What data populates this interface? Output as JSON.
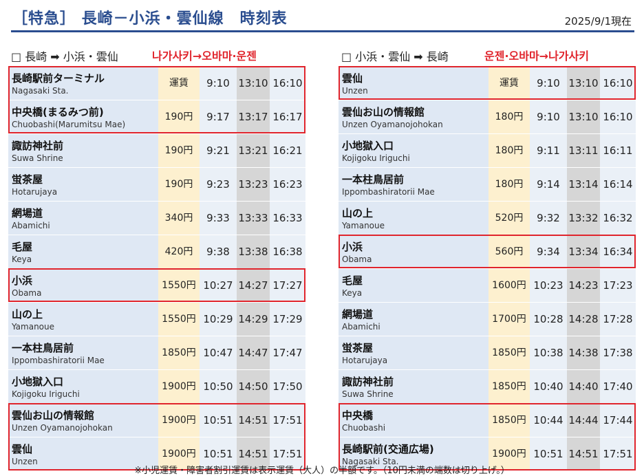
{
  "header": {
    "title": "［特急］ 長崎－小浜・雲仙線　時刻表",
    "date": "2025/9/1現在"
  },
  "left": {
    "direction": "□ 長崎 ➡ 小浜・雲仙",
    "korean": "나가사키→오바마·운젠",
    "rows": [
      {
        "ja": "長崎駅前ターミナル",
        "en": "Nagasaki Sta.",
        "fare": "運賃",
        "t1": "9:10",
        "t2": "13:10",
        "t3": "16:10"
      },
      {
        "ja": "中央橋(まるみつ前)",
        "en": "Chuobashi(Marumitsu Mae)",
        "fare": "190円",
        "t1": "9:17",
        "t2": "13:17",
        "t3": "16:17"
      },
      {
        "ja": "諏訪神社前",
        "en": "Suwa Shrine",
        "fare": "190円",
        "t1": "9:21",
        "t2": "13:21",
        "t3": "16:21"
      },
      {
        "ja": "蛍茶屋",
        "en": "Hotarujaya",
        "fare": "190円",
        "t1": "9:23",
        "t2": "13:23",
        "t3": "16:23"
      },
      {
        "ja": "網場道",
        "en": "Abamichi",
        "fare": "340円",
        "t1": "9:33",
        "t2": "13:33",
        "t3": "16:33"
      },
      {
        "ja": "毛屋",
        "en": "Keya",
        "fare": "420円",
        "t1": "9:38",
        "t2": "13:38",
        "t3": "16:38"
      },
      {
        "ja": "小浜",
        "en": "Obama",
        "fare": "1550円",
        "t1": "10:27",
        "t2": "14:27",
        "t3": "17:27"
      },
      {
        "ja": "山の上",
        "en": "Yamanoue",
        "fare": "1550円",
        "t1": "10:29",
        "t2": "14:29",
        "t3": "17:29"
      },
      {
        "ja": "一本柱鳥居前",
        "en": "Ippombashiratorii Mae",
        "fare": "1850円",
        "t1": "10:47",
        "t2": "14:47",
        "t3": "17:47"
      },
      {
        "ja": "小地獄入口",
        "en": "Kojigoku Iriguchi",
        "fare": "1900円",
        "t1": "10:50",
        "t2": "14:50",
        "t3": "17:50"
      },
      {
        "ja": "雲仙お山の情報館",
        "en": "Unzen Oyamanojohokan",
        "fare": "1900円",
        "t1": "10:51",
        "t2": "14:51",
        "t3": "17:51"
      },
      {
        "ja": "雲仙",
        "en": "Unzen",
        "fare": "1900円",
        "t1": "10:51",
        "t2": "14:51",
        "t3": "17:51"
      }
    ]
  },
  "right": {
    "direction": "□ 小浜・雲仙 ➡ 長崎",
    "korean": "운젠·오바마→나가사키",
    "rows": [
      {
        "ja": "雲仙",
        "en": "Unzen",
        "fare": "運賃",
        "t1": "9:10",
        "t2": "13:10",
        "t3": "16:10"
      },
      {
        "ja": "雲仙お山の情報館",
        "en": "Unzen Oyamanojohokan",
        "fare": "180円",
        "t1": "9:10",
        "t2": "13:10",
        "t3": "16:10"
      },
      {
        "ja": "小地獄入口",
        "en": "Kojigoku Iriguchi",
        "fare": "180円",
        "t1": "9:11",
        "t2": "13:11",
        "t3": "16:11"
      },
      {
        "ja": "一本柱鳥居前",
        "en": "Ippombashiratorii Mae",
        "fare": "180円",
        "t1": "9:14",
        "t2": "13:14",
        "t3": "16:14"
      },
      {
        "ja": "山の上",
        "en": "Yamanoue",
        "fare": "520円",
        "t1": "9:32",
        "t2": "13:32",
        "t3": "16:32"
      },
      {
        "ja": "小浜",
        "en": "Obama",
        "fare": "560円",
        "t1": "9:34",
        "t2": "13:34",
        "t3": "16:34"
      },
      {
        "ja": "毛屋",
        "en": "Keya",
        "fare": "1600円",
        "t1": "10:23",
        "t2": "14:23",
        "t3": "17:23"
      },
      {
        "ja": "網場道",
        "en": "Abamichi",
        "fare": "1700円",
        "t1": "10:28",
        "t2": "14:28",
        "t3": "17:28"
      },
      {
        "ja": "蛍茶屋",
        "en": "Hotarujaya",
        "fare": "1850円",
        "t1": "10:38",
        "t2": "14:38",
        "t3": "17:38"
      },
      {
        "ja": "諏訪神社前",
        "en": "Suwa Shrine",
        "fare": "1850円",
        "t1": "10:40",
        "t2": "14:40",
        "t3": "17:40"
      },
      {
        "ja": "中央橋",
        "en": "Chuobashi",
        "fare": "1850円",
        "t1": "10:44",
        "t2": "14:44",
        "t3": "17:44"
      },
      {
        "ja": "長崎駅前(交通広場)",
        "en": "Nagasaki Sta.",
        "fare": "1900円",
        "t1": "10:51",
        "t2": "14:51",
        "t3": "17:51"
      }
    ]
  },
  "footnote": "※小児運賃・障害者割引運賃は表示運賃（大人）の半額です。（10円未満の端数は切り上げ。）"
}
